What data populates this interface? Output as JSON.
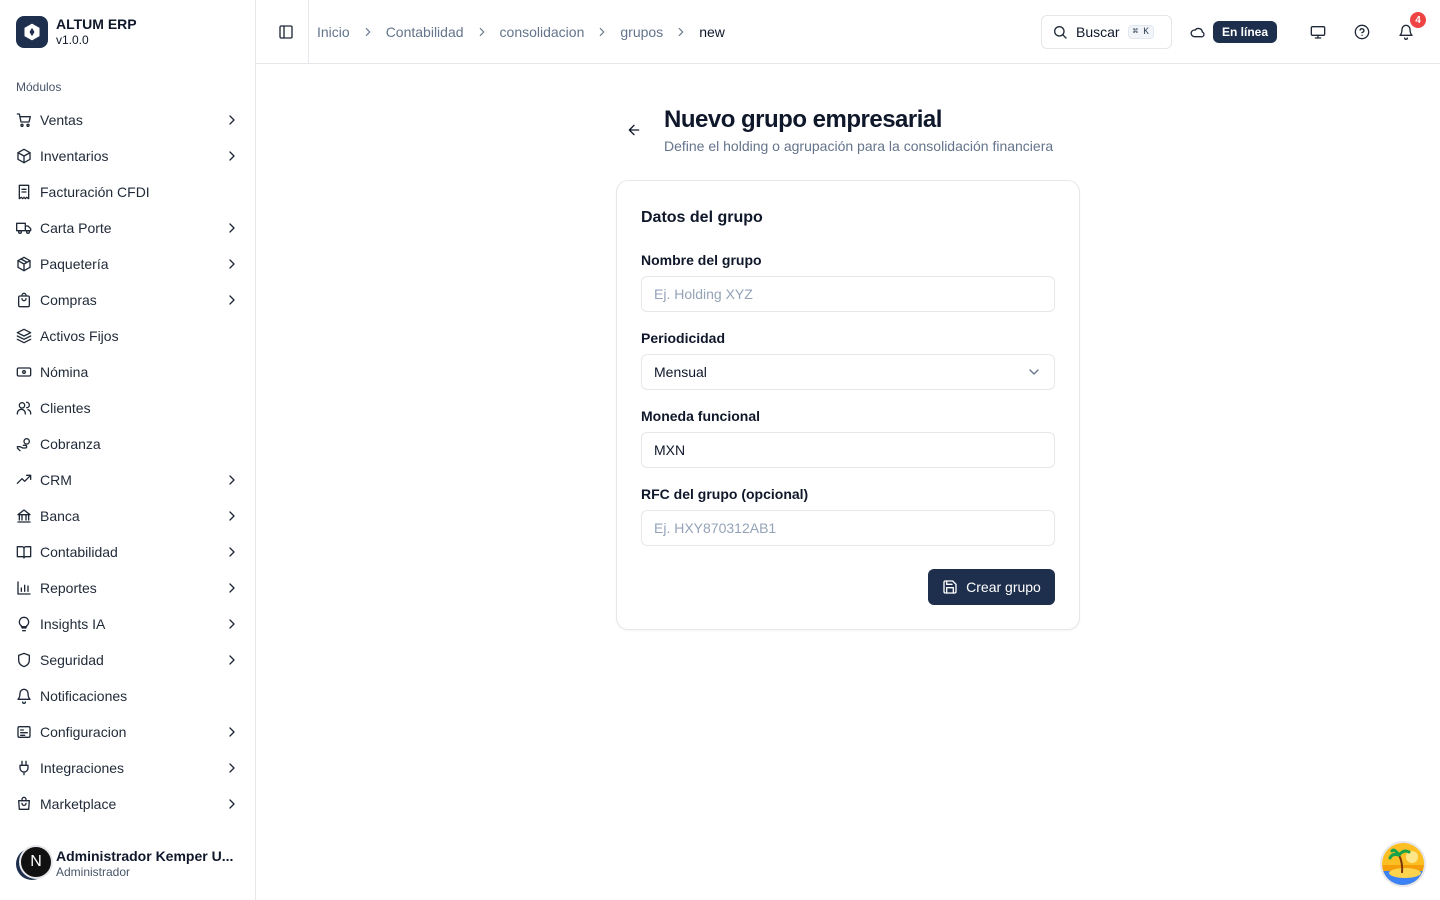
{
  "brand": {
    "name": "ALTUM ERP",
    "version": "v1.0.0"
  },
  "sidebar": {
    "section_label": "Módulos",
    "items": [
      {
        "label": "Ventas",
        "icon": "cart-icon",
        "has_submenu": true
      },
      {
        "label": "Inventarios",
        "icon": "box-icon",
        "has_submenu": true
      },
      {
        "label": "Facturación CFDI",
        "icon": "receipt-icon",
        "has_submenu": false
      },
      {
        "label": "Carta Porte",
        "icon": "truck-icon",
        "has_submenu": true
      },
      {
        "label": "Paquetería",
        "icon": "package-icon",
        "has_submenu": true
      },
      {
        "label": "Compras",
        "icon": "shopping-bag-icon",
        "has_submenu": true
      },
      {
        "label": "Activos Fijos",
        "icon": "layers-icon",
        "has_submenu": false
      },
      {
        "label": "Nómina",
        "icon": "banknote-icon",
        "has_submenu": false
      },
      {
        "label": "Clientes",
        "icon": "users-icon",
        "has_submenu": false
      },
      {
        "label": "Cobranza",
        "icon": "hand-coins-icon",
        "has_submenu": false
      },
      {
        "label": "CRM",
        "icon": "trending-up-icon",
        "has_submenu": true
      },
      {
        "label": "Banca",
        "icon": "bank-icon",
        "has_submenu": true
      },
      {
        "label": "Contabilidad",
        "icon": "book-icon",
        "has_submenu": true
      },
      {
        "label": "Reportes",
        "icon": "bar-chart-icon",
        "has_submenu": true
      },
      {
        "label": "Insights IA",
        "icon": "lightbulb-icon",
        "has_submenu": true
      },
      {
        "label": "Seguridad",
        "icon": "shield-icon",
        "has_submenu": true
      },
      {
        "label": "Notificaciones",
        "icon": "bell-icon",
        "has_submenu": false
      },
      {
        "label": "Configuracion",
        "icon": "sliders-icon",
        "has_submenu": true
      },
      {
        "label": "Integraciones",
        "icon": "plug-icon",
        "has_submenu": true
      },
      {
        "label": "Marketplace",
        "icon": "store-icon",
        "has_submenu": true
      }
    ]
  },
  "user": {
    "name": "Administrador Kemper U...",
    "role": "Administrador",
    "avatar_letter": "N"
  },
  "header": {
    "breadcrumb": [
      "Inicio",
      "Contabilidad",
      "consolidacion",
      "grupos",
      "new"
    ],
    "search_label": "Buscar",
    "search_shortcut": "⌘ K",
    "status_badge": "En línea",
    "notification_count": "4"
  },
  "page": {
    "title": "Nuevo grupo empresarial",
    "subtitle": "Define el holding o agrupación para la consolidación financiera"
  },
  "form": {
    "card_title": "Datos del grupo",
    "name_label": "Nombre del grupo",
    "name_placeholder": "Ej. Holding XYZ",
    "name_value": "",
    "period_label": "Periodicidad",
    "period_value": "Mensual",
    "currency_label": "Moneda funcional",
    "currency_value": "MXN",
    "rfc_label": "RFC del grupo (opcional)",
    "rfc_placeholder": "Ej. HXY870312AB1",
    "rfc_value": "",
    "submit_label": "Crear grupo"
  },
  "colors": {
    "primary": "#1e2f4d",
    "badge_red": "#ef4444",
    "muted_text": "#64748b"
  }
}
